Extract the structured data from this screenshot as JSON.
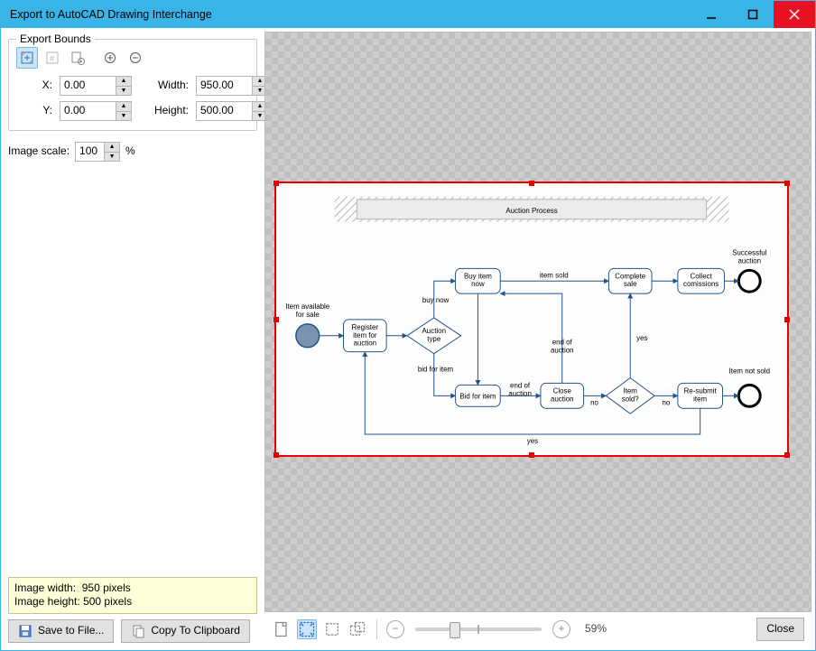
{
  "window": {
    "title": "Export to AutoCAD Drawing Interchange"
  },
  "bounds": {
    "legend": "Export Bounds",
    "x_label": "X:",
    "x_value": "0.00",
    "y_label": "Y:",
    "y_value": "0.00",
    "width_label": "Width:",
    "width_value": "950.00",
    "height_label": "Height:",
    "height_value": "500.00"
  },
  "scale": {
    "label": "Image scale:",
    "value": "100",
    "unit": "%"
  },
  "status": {
    "width_label": "Image width:",
    "width_value": "950 pixels",
    "height_label": "Image height:",
    "height_value": "500 pixels"
  },
  "buttons": {
    "save": "Save to File...",
    "copy": "Copy To Clipboard",
    "close": "Close"
  },
  "zoom": {
    "value": "59%"
  },
  "diagram": {
    "title": "Auction Process",
    "start_label": "Item available\nfor sale",
    "nodes": {
      "register": "Register\nitem for\nauction",
      "auction_type": "Auction\ntype",
      "buy_now": "Buy item\nnow",
      "bid": "Bid for item",
      "close_auction": "Close\nauction",
      "item_sold_q": "Item\nsold?",
      "resubmit": "Re-submit\nitem",
      "complete": "Complete\nsale",
      "collect": "Collect\ncomissions"
    },
    "end_labels": {
      "success": "Successful\nauction",
      "not_sold": "Item not sold"
    },
    "edge_labels": {
      "buy_now": "buy now",
      "bid_for_item": "bid for item",
      "item_sold": "item sold",
      "end_of_auction": "end of\nauction",
      "end_of_auction2": "end of\nauction",
      "no1": "no",
      "no2": "no",
      "yes1": "yes",
      "yes_loop": "yes"
    }
  }
}
